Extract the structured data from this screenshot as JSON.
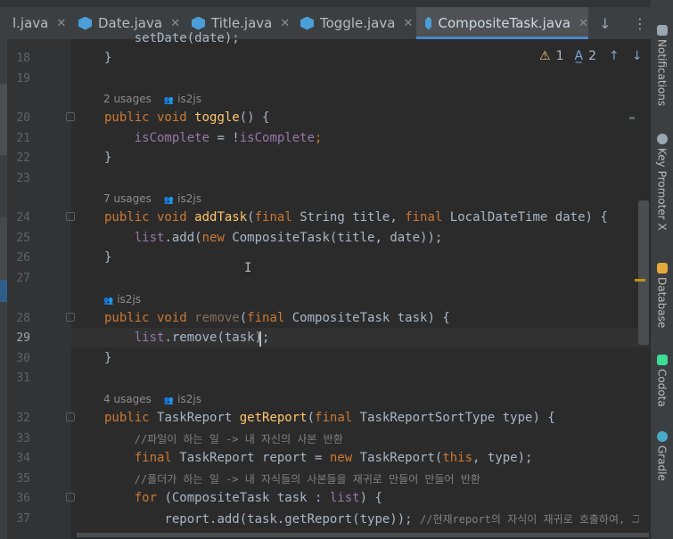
{
  "tabs": [
    {
      "label": "l.java",
      "active": false
    },
    {
      "label": "Date.java",
      "active": false
    },
    {
      "label": "Title.java",
      "active": false
    },
    {
      "label": "Toggle.java",
      "active": false
    },
    {
      "label": "CompositeTask.java",
      "active": true
    }
  ],
  "tab_close_glyph": "✕",
  "inspections": {
    "warnings": "1",
    "typos": "2"
  },
  "side_panels": [
    "Notifications",
    "Key Promoter X",
    "Database",
    "Codota",
    "Gradle"
  ],
  "author": "is2js",
  "lines": {
    "l18": {
      "num": "18",
      "text": "}"
    },
    "l19": {
      "num": "19"
    },
    "u1": "2 usages",
    "l20": {
      "num": "20",
      "kw": "public void ",
      "fn": "toggle",
      "rest": "() {"
    },
    "l21": {
      "num": "21",
      "f1": "isComplete",
      "mid": " = !",
      "f2": "isComplete",
      "end": ";"
    },
    "l22": {
      "num": "22",
      "text": "}"
    },
    "l23": {
      "num": "23"
    },
    "u2": "7 usages",
    "l24": {
      "num": "24",
      "kw": "public void ",
      "fn": "addTask",
      "a": "(",
      "k1": "final ",
      "b": "String title, ",
      "k2": "final ",
      "c": "LocalDateTime date) {"
    },
    "l25": {
      "num": "25",
      "f": "list",
      "a": ".add(",
      "k": "new ",
      "b": "CompositeTask(title, date));"
    },
    "l26": {
      "num": "26",
      "text": "}"
    },
    "l27": {
      "num": "27"
    },
    "l28": {
      "num": "28",
      "kw": "public void ",
      "fn": "remove",
      "a": "(",
      "k": "final ",
      "b": "CompositeTask task) {"
    },
    "l29": {
      "num": "29",
      "f": "list",
      "b": ".remove(task);"
    },
    "l30": {
      "num": "30",
      "text": "}"
    },
    "l31": {
      "num": "31"
    },
    "u3": "4 usages",
    "l32": {
      "num": "32",
      "kw": "public ",
      "t": "TaskReport ",
      "fn": "getReport",
      "a": "(",
      "k": "final ",
      "b": "TaskReportSortType type) {"
    },
    "l33": {
      "num": "33",
      "cm": "//파일이 하는 일 -> 내 자신의 사본 반환"
    },
    "l34": {
      "num": "34",
      "k1": "final ",
      "a": "TaskReport report = ",
      "k2": "new ",
      "b": "TaskReport(",
      "k3": "this",
      "c": ", type);"
    },
    "l35": {
      "num": "35",
      "cm": "//폴더가 하는 일 -> 내 자식들의 사본들을 재귀로 만들어 만들어 반환"
    },
    "l36": {
      "num": "36",
      "k": "for ",
      "a": "(CompositeTask task : ",
      "f": "list",
      "b": ") {"
    },
    "l37": {
      "num": "37",
      "a": "report.add(task.getReport(type)); ",
      "cm": "//현재report의 자식이 재귀로 호출하여, 그"
    }
  },
  "colors": {
    "keyword": "#cc7832",
    "method": "#ffc66d",
    "field": "#9876aa",
    "comment": "#808080",
    "text": "#a9b7c6"
  }
}
